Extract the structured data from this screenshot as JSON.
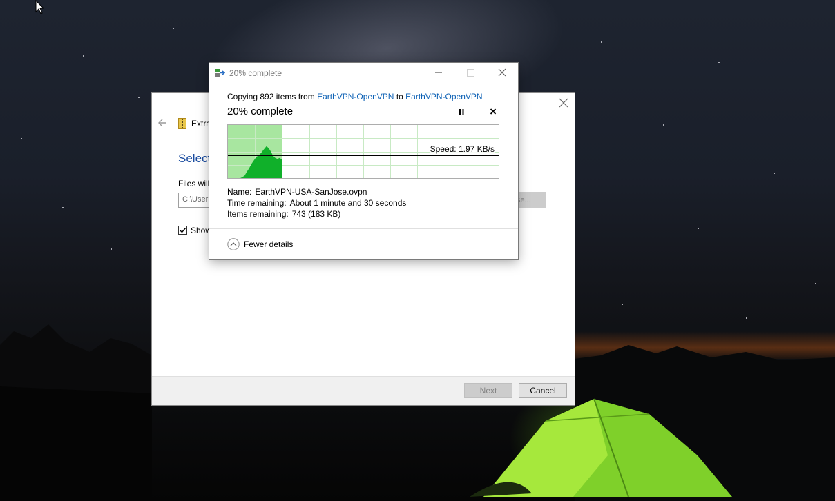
{
  "dialog": {
    "title": "20% complete",
    "copying_prefix": "Copying 892 items from",
    "source": "EarthVPN-OpenVPN",
    "to_word": "to",
    "destination": "EarthVPN-OpenVPN",
    "heading": "20% complete",
    "progress_fraction": 0.2,
    "speed": "Speed: 1.97 KB/s",
    "name_label": "Name:",
    "name_value": "EarthVPN-USA-SanJose.ovpn",
    "time_label": "Time remaining:",
    "time_value": "About 1 minute and 30 seconds",
    "items_label": "Items remaining:",
    "items_value": "743 (183 KB)",
    "fewer_details": "Fewer details",
    "icons": {
      "app": "copy-transfer-icon",
      "minimize": "minimize-icon",
      "maximize": "maximize-icon",
      "close": "close-icon",
      "pause": "pause-icon",
      "cancel": "cancel-icon",
      "chevron": "chevron-up-icon"
    },
    "colors": {
      "link": "#0a5fb4",
      "graph_fill": "#10b02a",
      "graph_progress_bg": "#a8e6a0",
      "graph_grid": "#c8eac4"
    }
  },
  "wizard": {
    "title": "Extra",
    "heading": "Select",
    "files_label": "Files will",
    "path": "C:\\User",
    "browse": "se...",
    "show_label": "Show",
    "show_checked": true,
    "next": "Next",
    "cancel": "Cancel"
  }
}
